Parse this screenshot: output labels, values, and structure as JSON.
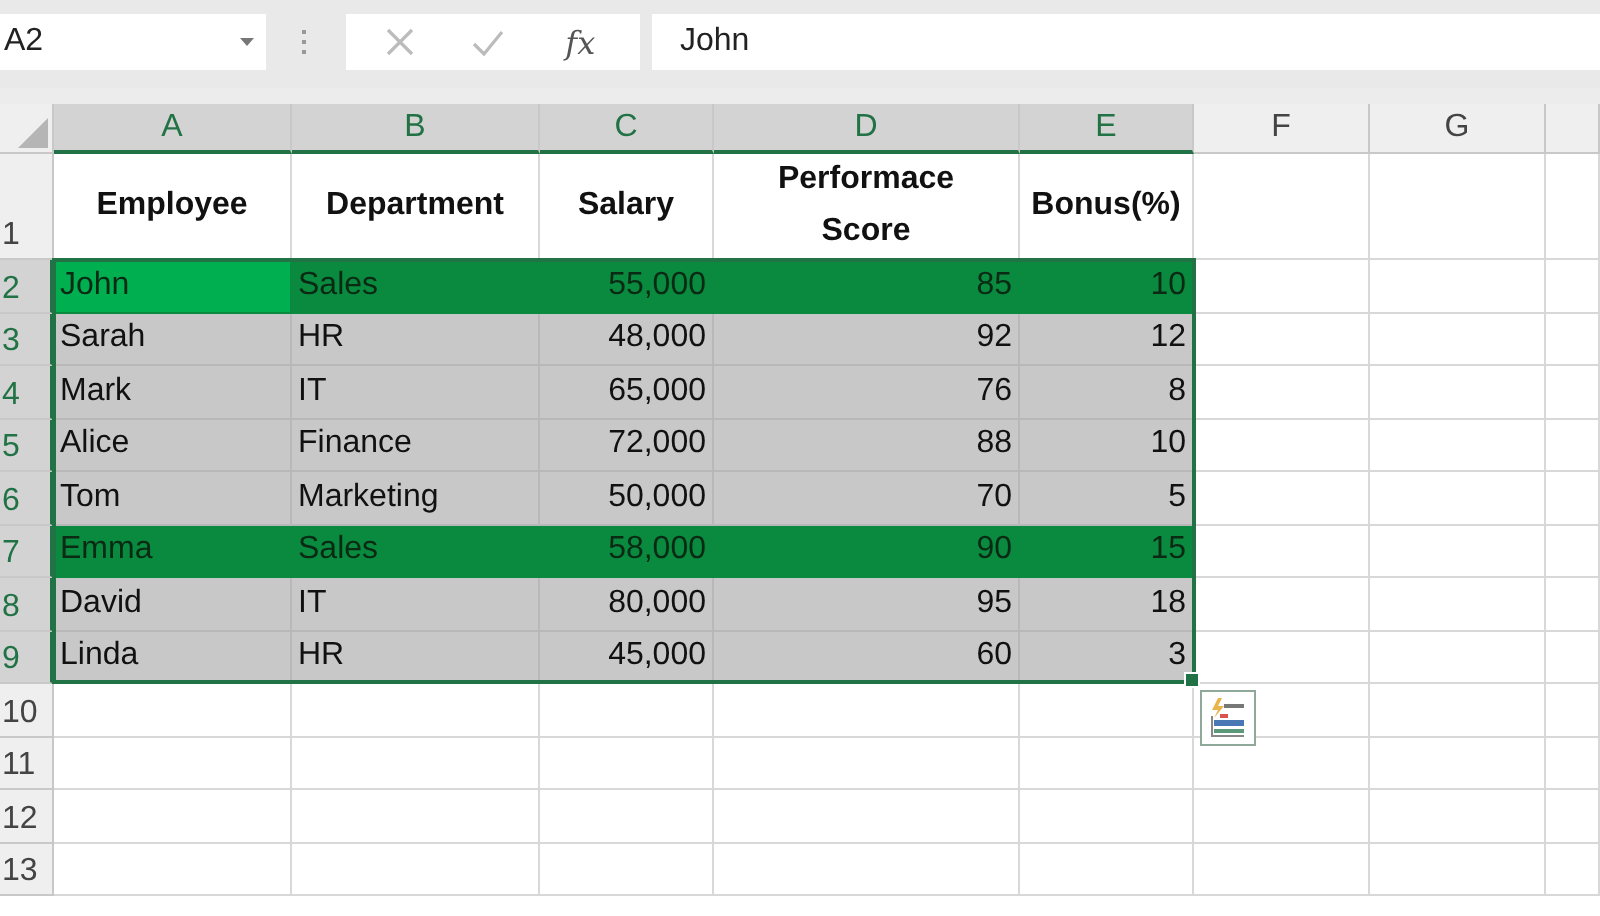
{
  "formula_bar": {
    "name_box": "A2",
    "function_button": "fx",
    "value": "John"
  },
  "columns": [
    {
      "label": "A",
      "selected": true
    },
    {
      "label": "B",
      "selected": true
    },
    {
      "label": "C",
      "selected": true
    },
    {
      "label": "D",
      "selected": true
    },
    {
      "label": "E",
      "selected": true
    },
    {
      "label": "F",
      "selected": false
    },
    {
      "label": "G",
      "selected": false
    }
  ],
  "header_row": {
    "number": "1",
    "selected": false,
    "cells": [
      "Employee",
      "Department",
      "Salary",
      "Performace Score",
      "Bonus(%)"
    ]
  },
  "rows": [
    {
      "number": "2",
      "selected": true,
      "highlighted": true,
      "active": true,
      "cells": [
        "John",
        "Sales",
        "55,000",
        "85",
        "10"
      ]
    },
    {
      "number": "3",
      "selected": true,
      "highlighted": false,
      "active": false,
      "cells": [
        "Sarah",
        "HR",
        "48,000",
        "92",
        "12"
      ]
    },
    {
      "number": "4",
      "selected": true,
      "highlighted": false,
      "active": false,
      "cells": [
        "Mark",
        "IT",
        "65,000",
        "76",
        "8"
      ]
    },
    {
      "number": "5",
      "selected": true,
      "highlighted": false,
      "active": false,
      "cells": [
        "Alice",
        "Finance",
        "72,000",
        "88",
        "10"
      ]
    },
    {
      "number": "6",
      "selected": true,
      "highlighted": false,
      "active": false,
      "cells": [
        "Tom",
        "Marketing",
        "50,000",
        "70",
        "5"
      ]
    },
    {
      "number": "7",
      "selected": true,
      "highlighted": true,
      "active": false,
      "cells": [
        "Emma",
        "Sales",
        "58,000",
        "90",
        "15"
      ]
    },
    {
      "number": "8",
      "selected": true,
      "highlighted": false,
      "active": false,
      "cells": [
        "David",
        "IT",
        "80,000",
        "95",
        "18"
      ]
    },
    {
      "number": "9",
      "selected": true,
      "highlighted": false,
      "active": false,
      "cells": [
        "Linda",
        "HR",
        "45,000",
        "60",
        "3"
      ]
    }
  ],
  "empty_rows": [
    {
      "number": "10",
      "selected": false
    },
    {
      "number": "11",
      "selected": false
    },
    {
      "number": "12",
      "selected": false
    },
    {
      "number": "13",
      "selected": false
    }
  ]
}
